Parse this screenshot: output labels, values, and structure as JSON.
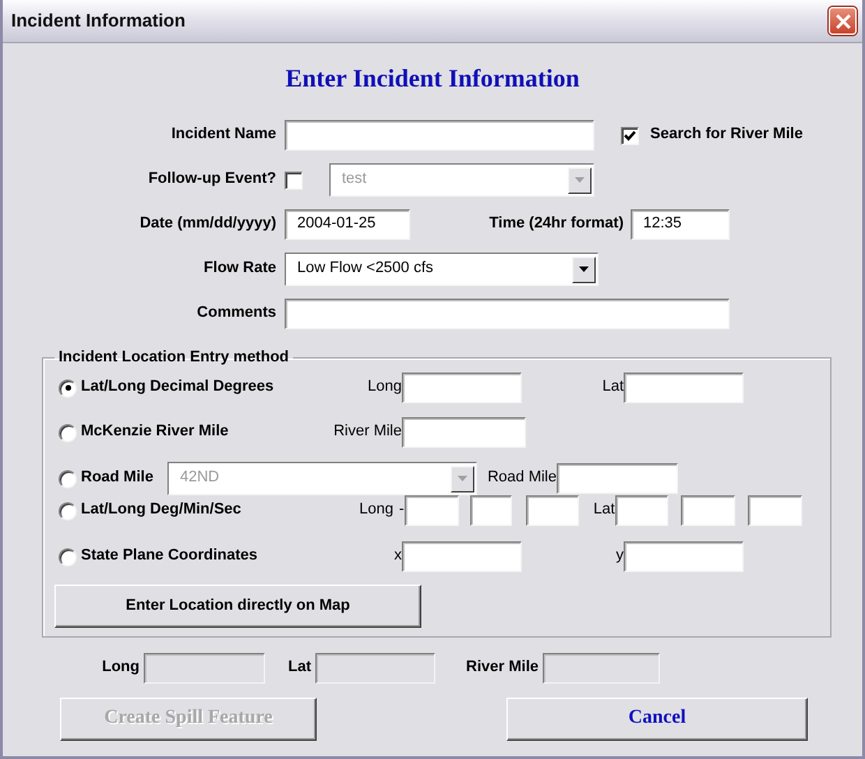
{
  "window": {
    "title": "Incident Information"
  },
  "heading": "Enter Incident Information",
  "incident_name": {
    "label": "Incident Name"
  },
  "search_river_mile": {
    "label": "Search for River Mile",
    "checked": true
  },
  "follow_up": {
    "label": "Follow-up Event?",
    "checked": false,
    "combo": {
      "value": "test",
      "disabled": true
    }
  },
  "date": {
    "label": "Date (mm/dd/yyyy)",
    "value": "2004-01-25"
  },
  "time": {
    "label": "Time (24hr format)",
    "value": "12:35"
  },
  "flow_rate": {
    "label": "Flow Rate",
    "value": "Low Flow <2500 cfs",
    "disabled": false
  },
  "comments": {
    "label": "Comments"
  },
  "location": {
    "legend": "Incident Location Entry method",
    "methods": [
      {
        "kind": "decimal",
        "label": "Lat/Long Decimal Degrees",
        "selected": true,
        "fields": [
          {
            "label": "Long"
          },
          {
            "label": "Lat"
          }
        ]
      },
      {
        "kind": "river",
        "label": "McKenzie River Mile",
        "selected": false,
        "fields": [
          {
            "label": "River Mile"
          }
        ]
      },
      {
        "kind": "road",
        "label": "Road Mile",
        "selected": false,
        "combo": {
          "value": "42ND",
          "disabled": true
        },
        "fields": [
          {
            "label": "Road Mile"
          }
        ]
      },
      {
        "kind": "dms",
        "label": "Lat/Long Deg/Min/Sec",
        "selected": false,
        "fields": [
          {
            "label": "Long",
            "sign": "-"
          },
          {
            "label": "Lat"
          }
        ]
      },
      {
        "kind": "plane",
        "label": "State Plane Coordinates",
        "selected": false,
        "fields": [
          {
            "label": "x"
          },
          {
            "label": "y"
          }
        ]
      }
    ],
    "map_button": "Enter Location directly on Map"
  },
  "result": [
    {
      "label": "Long",
      "disabled": true
    },
    {
      "label": "Lat",
      "disabled": true
    },
    {
      "label": "River Mile",
      "disabled": true
    }
  ],
  "buttons": [
    {
      "label": "Create Spill Feature",
      "disabled": true
    },
    {
      "label": "Cancel",
      "disabled": false
    }
  ]
}
